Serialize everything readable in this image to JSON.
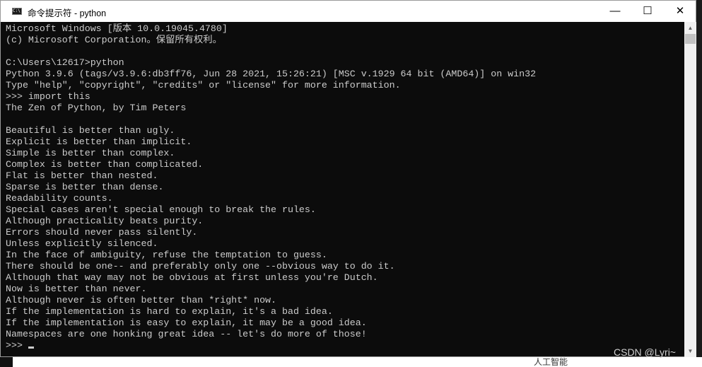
{
  "window": {
    "title": "命令提示符 - python",
    "icon": "cmd-icon",
    "controls": {
      "minimize": "—",
      "maximize": "☐",
      "close": "✕"
    }
  },
  "console": {
    "lines": [
      "Microsoft Windows [版本 10.0.19045.4780]",
      "(c) Microsoft Corporation。保留所有权利。",
      "",
      "C:\\Users\\12617>python",
      "Python 3.9.6 (tags/v3.9.6:db3ff76, Jun 28 2021, 15:26:21) [MSC v.1929 64 bit (AMD64)] on win32",
      "Type \"help\", \"copyright\", \"credits\" or \"license\" for more information.",
      ">>> import this",
      "The Zen of Python, by Tim Peters",
      "",
      "Beautiful is better than ugly.",
      "Explicit is better than implicit.",
      "Simple is better than complex.",
      "Complex is better than complicated.",
      "Flat is better than nested.",
      "Sparse is better than dense.",
      "Readability counts.",
      "Special cases aren't special enough to break the rules.",
      "Although practicality beats purity.",
      "Errors should never pass silently.",
      "Unless explicitly silenced.",
      "In the face of ambiguity, refuse the temptation to guess.",
      "There should be one-- and preferably only one --obvious way to do it.",
      "Although that way may not be obvious at first unless you're Dutch.",
      "Now is better than never.",
      "Although never is often better than *right* now.",
      "If the implementation is hard to explain, it's a bad idea.",
      "If the implementation is easy to explain, it may be a good idea.",
      "Namespaces are one honking great idea -- let's do more of those!"
    ],
    "prompt": ">>>"
  },
  "background": {
    "bottom_text": "人工智能"
  },
  "watermark": "CSDN @Lyri~"
}
